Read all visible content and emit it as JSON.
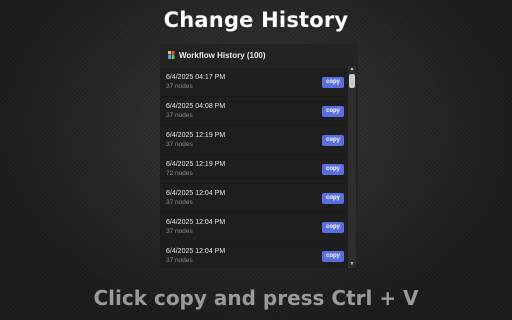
{
  "heading": "Change History",
  "caption": "Click copy and press Ctrl + V",
  "panel": {
    "title": "Workflow History (100)",
    "icon": "app-icon",
    "copy_label": "copy",
    "entries": [
      {
        "date": "6/4/2025 04:17 PM",
        "nodes": "37 nodes"
      },
      {
        "date": "6/4/2025 04:08 PM",
        "nodes": "37 nodes"
      },
      {
        "date": "6/4/2025 12:19 PM",
        "nodes": "37 nodes"
      },
      {
        "date": "6/4/2025 12:19 PM",
        "nodes": "72 nodes"
      },
      {
        "date": "6/4/2025 12:04 PM",
        "nodes": "37 nodes"
      },
      {
        "date": "6/4/2025 12:04 PM",
        "nodes": "37 nodes"
      },
      {
        "date": "6/4/2025 12:04 PM",
        "nodes": "37 nodes"
      }
    ]
  },
  "colors": {
    "accent": "#5a6ee0",
    "panel_bg": "#232323",
    "row_bg": "#1e1e1e"
  }
}
